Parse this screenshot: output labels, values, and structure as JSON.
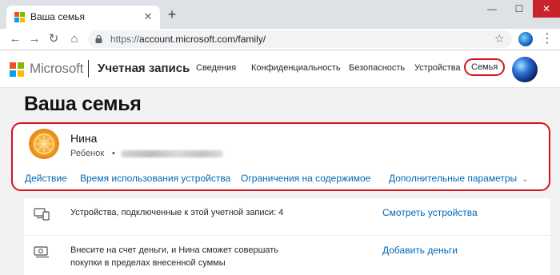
{
  "browser": {
    "tab_title": "Ваша семья",
    "tab_close_glyph": "✕",
    "new_tab_glyph": "+",
    "window_controls": {
      "minimize": "—",
      "maximize": "☐",
      "close": "✕"
    },
    "nav": {
      "back": "←",
      "forward": "→",
      "reload": "↻",
      "home": "⌂"
    },
    "url_scheme": "https://",
    "url_rest": "account.microsoft.com/family/",
    "bookmark_glyph": "☆",
    "menu_glyph": "⋮"
  },
  "header": {
    "brand": "Microsoft",
    "account_title": "Учетная запись",
    "nav": [
      {
        "label": "Сведения",
        "active": false
      },
      {
        "label": "Конфиденциальность",
        "active": false
      },
      {
        "label": "Безопасность",
        "active": false
      },
      {
        "label": "Устройства",
        "active": false
      },
      {
        "label": "Семья",
        "active": true
      }
    ]
  },
  "page": {
    "title": "Ваша семья"
  },
  "member": {
    "name": "Нина",
    "role": "Ребенок",
    "separator": "•",
    "links": [
      {
        "label": "Действие"
      },
      {
        "label": "Время использования устройства"
      },
      {
        "label": "Ограничения на содержимое"
      },
      {
        "label": "Дополнительные параметры"
      }
    ],
    "chevron_glyph": "⌄"
  },
  "info_rows": [
    {
      "icon": "devices-icon",
      "text": "Устройства, подключенные к этой учетной записи: 4",
      "link": "Смотреть устройства"
    },
    {
      "icon": "money-icon",
      "text": "Внесите на счет деньги, и Нина сможет совершать покупки в пределах внесенной суммы",
      "link": "Добавить деньги"
    }
  ],
  "colors": {
    "highlight": "#d2141c",
    "link": "#0067b8",
    "ms_red": "#f25022",
    "ms_green": "#7fba00",
    "ms_blue": "#00a4ef",
    "ms_yellow": "#ffb900"
  }
}
